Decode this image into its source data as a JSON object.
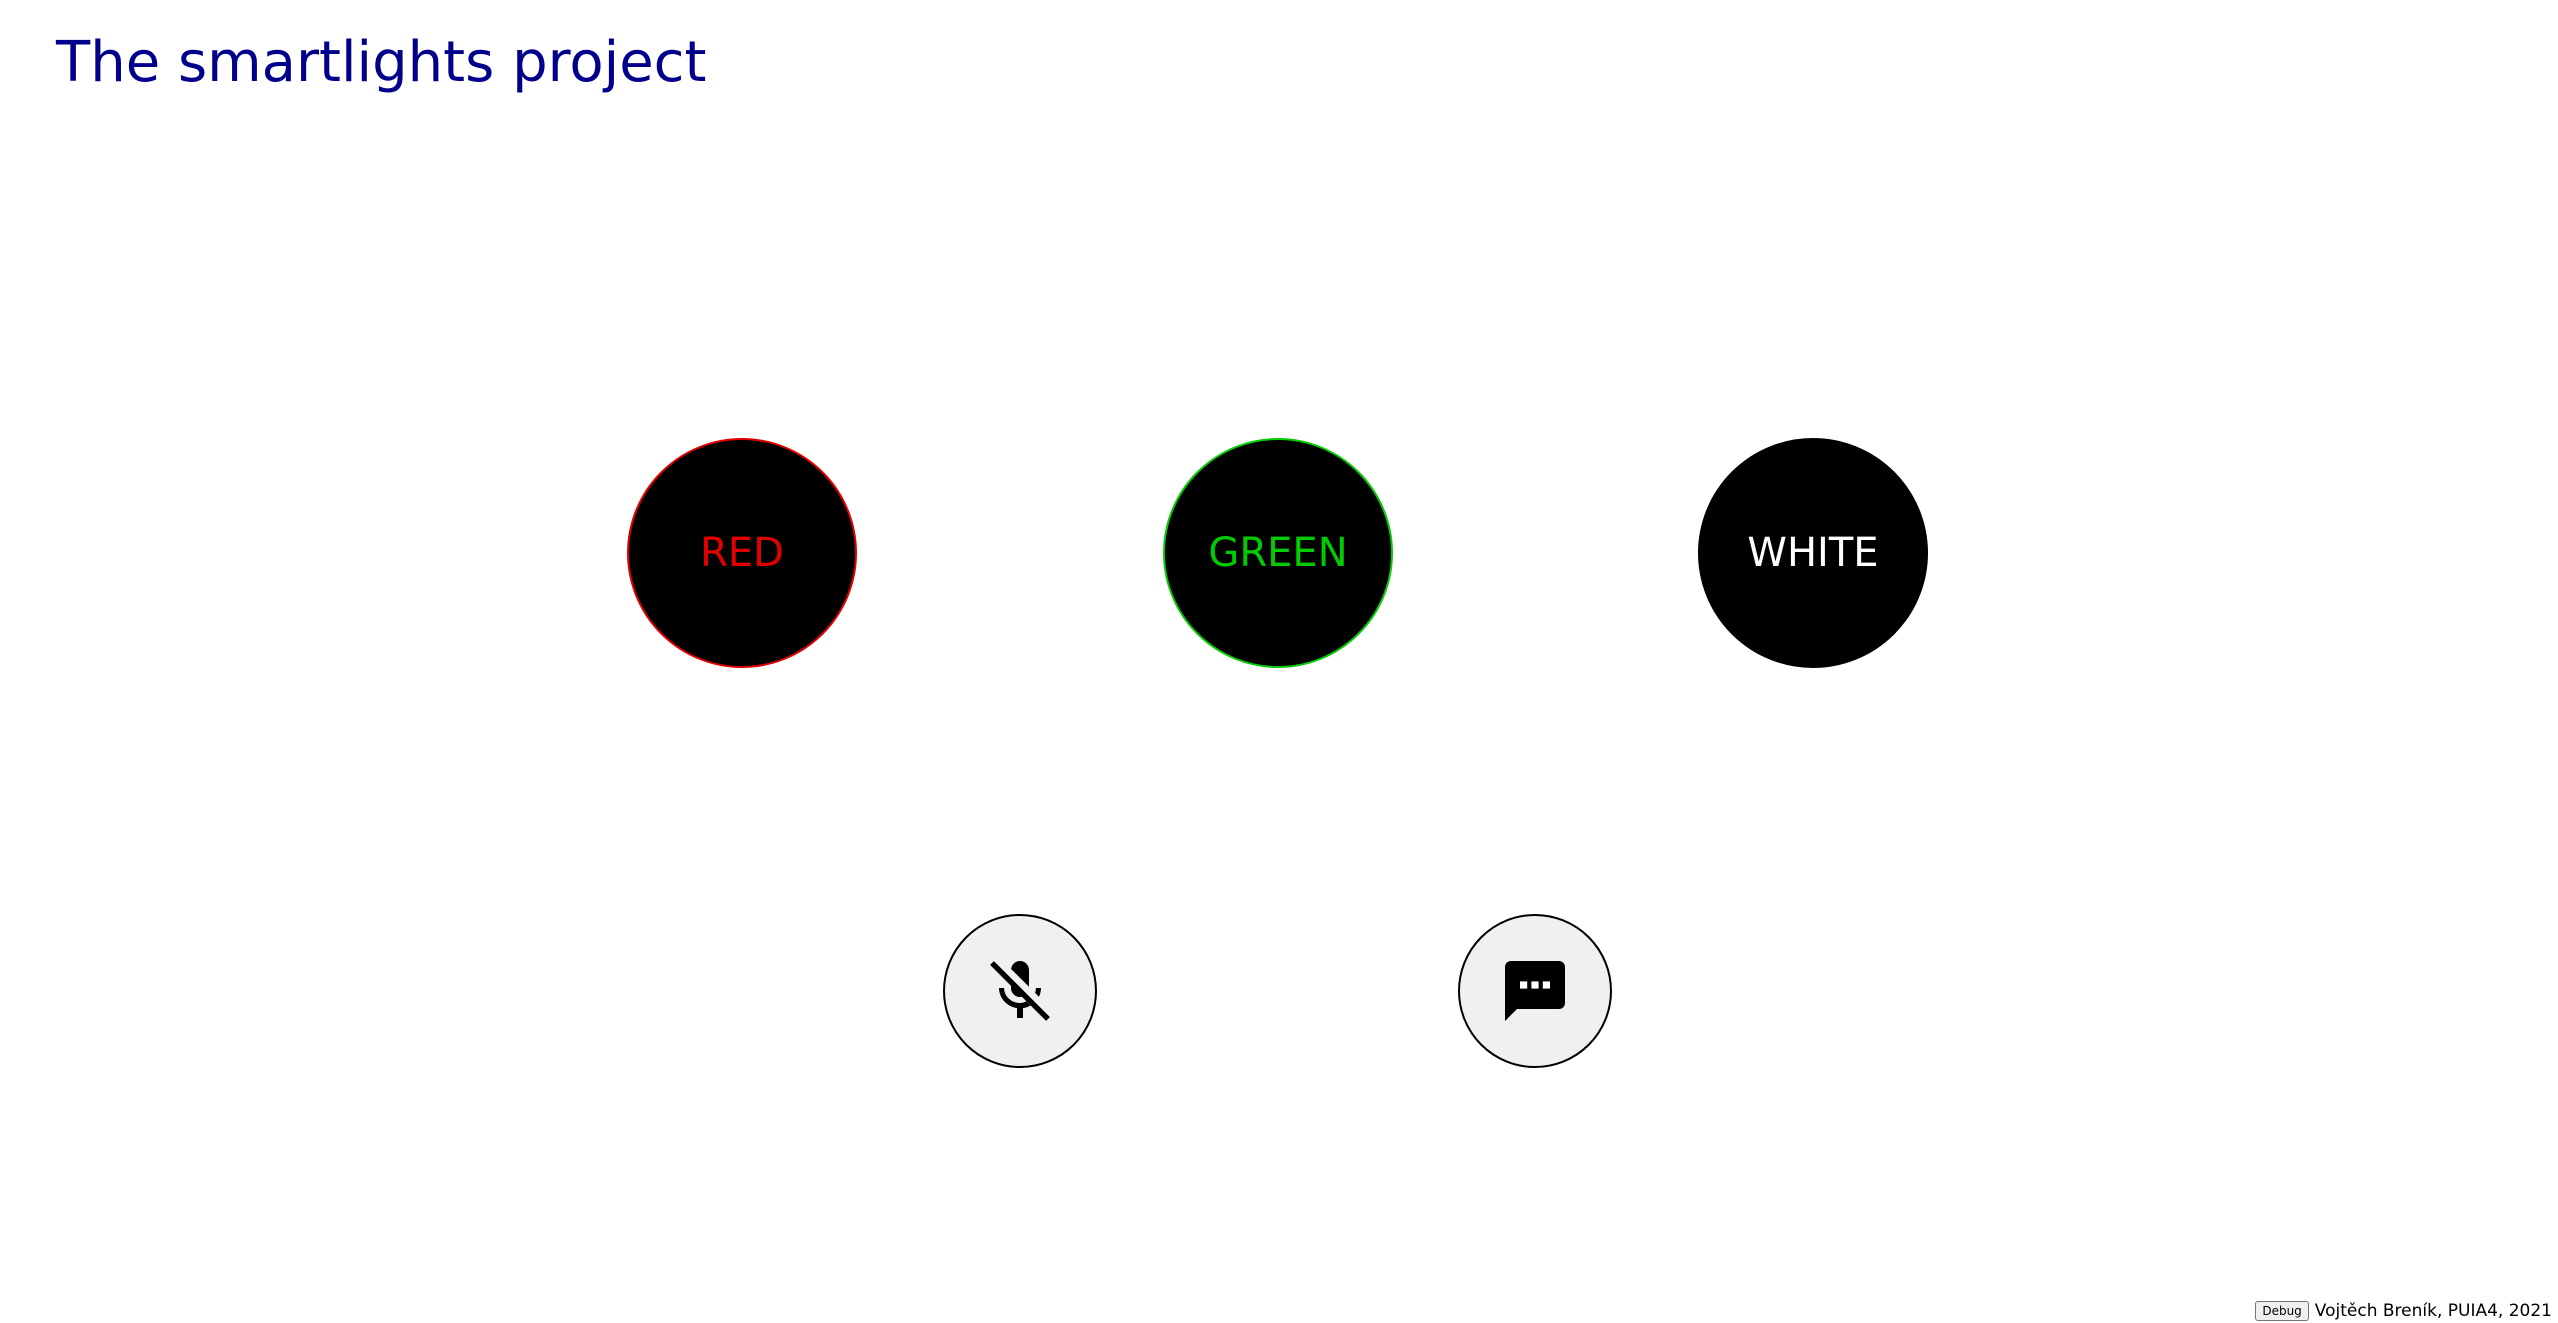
{
  "page": {
    "title": "The smartlights project",
    "title_color": "#00008b"
  },
  "lights": [
    {
      "label": "RED",
      "color": "#e00000"
    },
    {
      "label": "GREEN",
      "color": "#00cc00"
    },
    {
      "label": "WHITE",
      "color": "#ffffff"
    }
  ],
  "controls": {
    "mic_icon": "microphone-off-icon",
    "chat_icon": "chat-bubble-ellipsis-icon"
  },
  "footer": {
    "debug_label": "Debug",
    "credits": "Vojtěch Breník, PUIA4, 2021"
  }
}
